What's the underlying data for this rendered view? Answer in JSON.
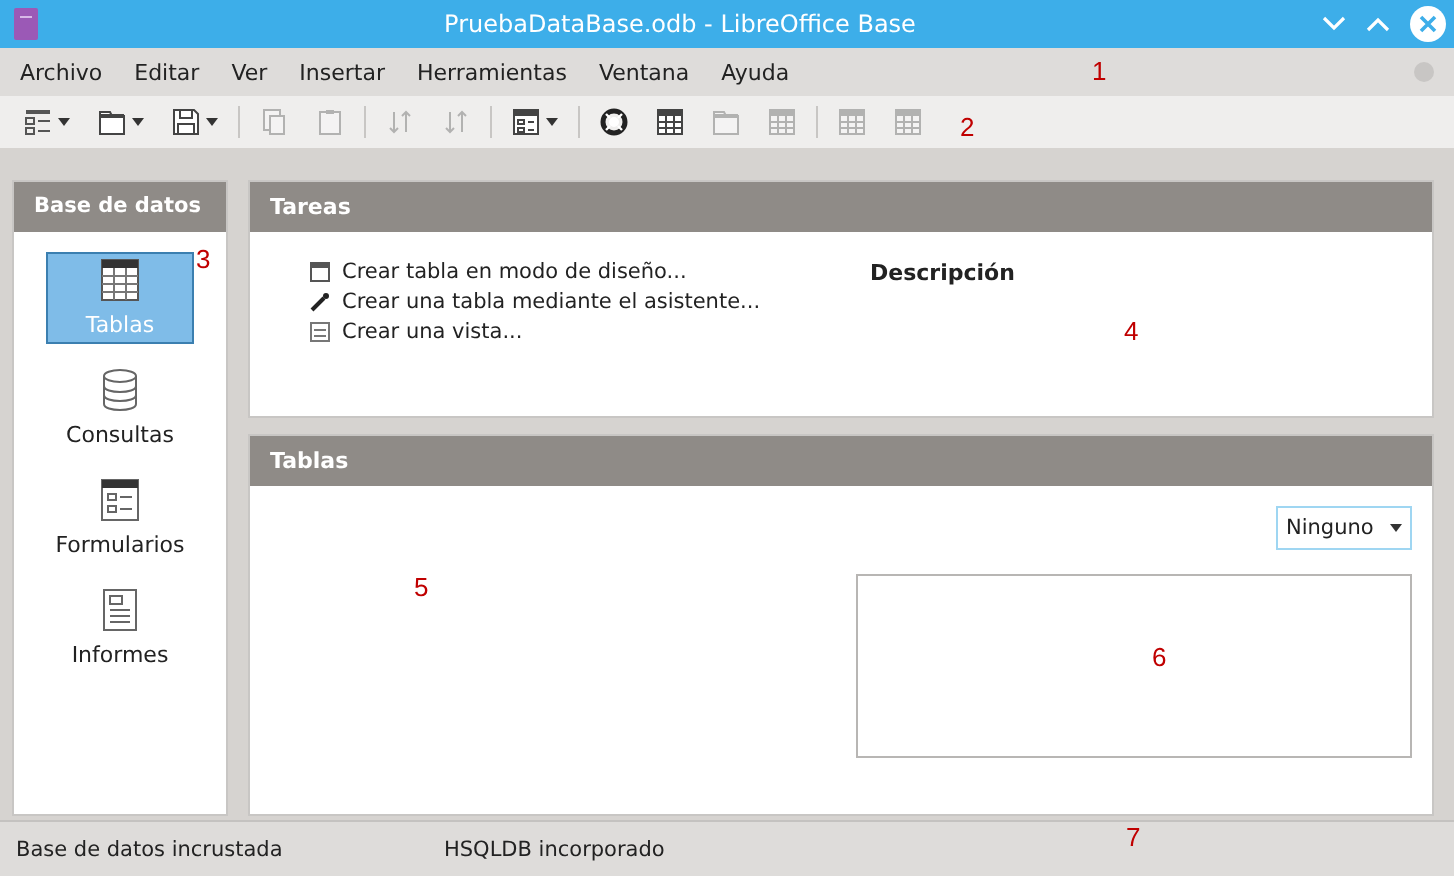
{
  "window": {
    "title": "PruebaDataBase.odb - LibreOffice Base"
  },
  "menu": [
    "Archivo",
    "Editar",
    "Ver",
    "Insertar",
    "Herramientas",
    "Ventana",
    "Ayuda"
  ],
  "toolbar": [
    {
      "kind": "list",
      "disabled": false,
      "dropdown": true
    },
    {
      "kind": "folder",
      "disabled": false,
      "dropdown": true
    },
    {
      "kind": "save",
      "disabled": false,
      "dropdown": true
    },
    {
      "kind": "separator"
    },
    {
      "kind": "copy",
      "disabled": true,
      "dropdown": false
    },
    {
      "kind": "paste",
      "disabled": true,
      "dropdown": false
    },
    {
      "kind": "separator"
    },
    {
      "kind": "sort",
      "disabled": true,
      "dropdown": false
    },
    {
      "kind": "sort",
      "disabled": true,
      "dropdown": false
    },
    {
      "kind": "separator"
    },
    {
      "kind": "form",
      "disabled": false,
      "dropdown": true
    },
    {
      "kind": "separator"
    },
    {
      "kind": "lifebuoy",
      "disabled": false,
      "dropdown": false
    },
    {
      "kind": "table",
      "disabled": false,
      "dropdown": false
    },
    {
      "kind": "folder",
      "disabled": true,
      "dropdown": false
    },
    {
      "kind": "table",
      "disabled": true,
      "dropdown": false
    },
    {
      "kind": "separator"
    },
    {
      "kind": "table",
      "disabled": true,
      "dropdown": false
    },
    {
      "kind": "table",
      "disabled": true,
      "dropdown": false
    }
  ],
  "sidebar": {
    "title": "Base de datos",
    "items": [
      {
        "label": "Tablas",
        "kind": "table",
        "selected": true
      },
      {
        "label": "Consultas",
        "kind": "query",
        "selected": false
      },
      {
        "label": "Formularios",
        "kind": "form",
        "selected": false
      },
      {
        "label": "Informes",
        "kind": "report",
        "selected": false
      }
    ]
  },
  "tasks": {
    "title": "Tareas",
    "items": [
      {
        "label": "Crear tabla en modo de diseño...",
        "kind": "design"
      },
      {
        "label": "Crear una tabla mediante el asistente...",
        "kind": "wizard"
      },
      {
        "label": "Crear una vista...",
        "kind": "view"
      }
    ],
    "description_heading": "Descripción"
  },
  "tables": {
    "title": "Tablas",
    "preview_select": "Ninguno"
  },
  "status_bar": [
    "Base de datos incrustada",
    "HSQLDB incorporado"
  ],
  "annotations": [
    "1",
    "2",
    "3",
    "4",
    "5",
    "6",
    "7"
  ]
}
